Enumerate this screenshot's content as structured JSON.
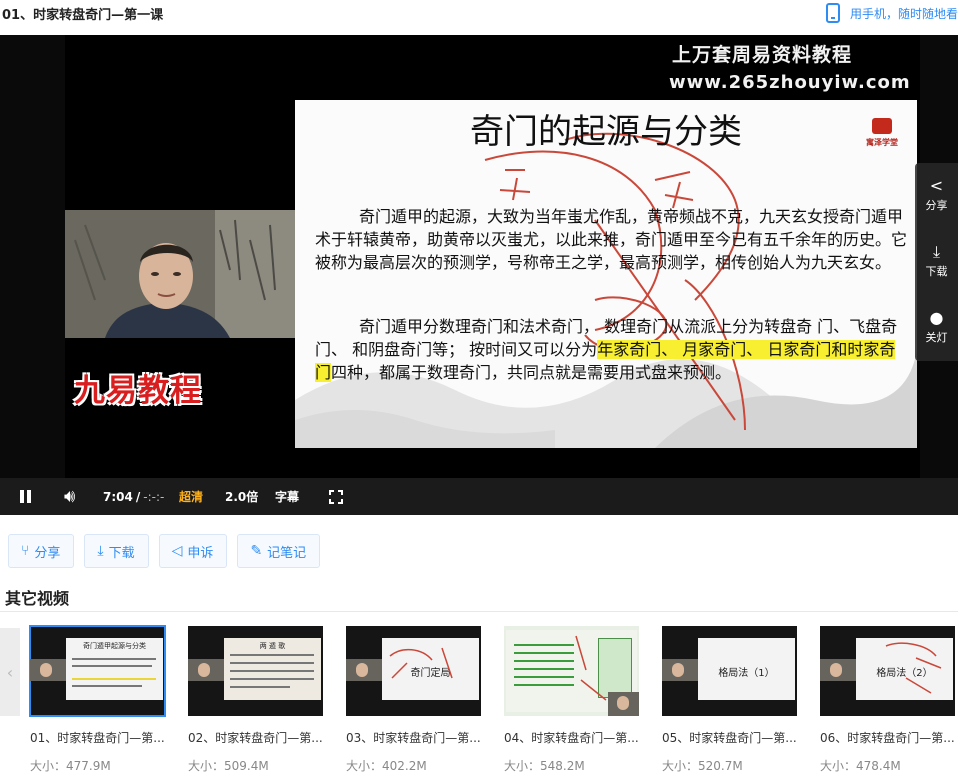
{
  "header": {
    "title": "01、时家转盘奇门—第一课",
    "mobile_link": "用手机，随时随地看"
  },
  "player": {
    "watermark_title": "上万套周易资料教程",
    "watermark_url": "www.265zhouyiw.com",
    "slide": {
      "title": "奇门的起源与分类",
      "logo_text": "寓泽学堂",
      "para1": "奇门遁甲的起源，大致为当年蚩尤作乱，黄帝频战不克，九天玄女授奇门遁甲术于轩辕黄帝，助黄帝以灭蚩尤，以此来推，奇门遁甲至今已有五千余年的历史。它被称为最高层次的预测学，号称帝王之学，最高预测学，相传创始人为九天玄女。",
      "para2_a": "奇门遁甲分数理奇门和法术奇门， 数理奇门从流派上分为转盘奇 门、飞盘奇门、 和阴盘奇门等； 按时间又可以分为",
      "para2_hl": "年家奇门、 月家奇门、 日家奇门和时家奇门",
      "para2_b": "四种，都属于数理奇门，共同点就是需要用式盘来预测。"
    },
    "brand": "九易教程",
    "side_panel": {
      "share": "分享",
      "download": "下载",
      "lights": "关灯"
    },
    "controls": {
      "time_current": "7:04",
      "time_sep": "/",
      "time_total": "-:-:-",
      "quality": "超清",
      "speed": "2.0倍",
      "subtitles": "字幕"
    }
  },
  "actions": [
    {
      "label": "分享",
      "icon": "share-icon"
    },
    {
      "label": "下载",
      "icon": "download-icon"
    },
    {
      "label": "申诉",
      "icon": "megaphone-icon"
    },
    {
      "label": "记笔记",
      "icon": "pencil-icon"
    }
  ],
  "other_videos": {
    "section_title": "其它视频",
    "items": [
      {
        "title": "01、时家转盘奇门—第...",
        "size": "大小：477.9M",
        "thumb_title": "奇门遁甲起源与分类",
        "thumb_big": ""
      },
      {
        "title": "02、时家转盘奇门—第...",
        "size": "大小：509.4M",
        "thumb_title": "两 遁 歌",
        "thumb_big": ""
      },
      {
        "title": "03、时家转盘奇门—第...",
        "size": "大小：402.2M",
        "thumb_title": "",
        "thumb_big": "奇门定局"
      },
      {
        "title": "04、时家转盘奇门—第...",
        "size": "大小：548.2M",
        "thumb_title": "",
        "thumb_big": ""
      },
      {
        "title": "05、时家转盘奇门—第...",
        "size": "大小：520.7M",
        "thumb_title": "",
        "thumb_big": "格局法（1）"
      },
      {
        "title": "06、时家转盘奇门—第...",
        "size": "大小：478.4M",
        "thumb_title": "",
        "thumb_big": "格局法（2）"
      }
    ]
  },
  "colors": {
    "accent": "#2f8cf2",
    "quality": "#ffb11b",
    "brand_red": "#d81e1e",
    "highlight": "#f7ef2f"
  }
}
